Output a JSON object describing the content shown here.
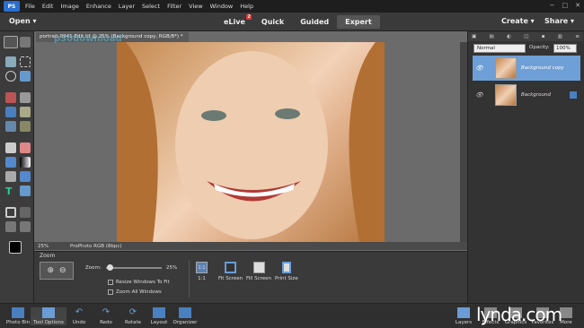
{
  "menubar": {
    "logo": "PS",
    "items": [
      "File",
      "Edit",
      "Image",
      "Enhance",
      "Layer",
      "Select",
      "Filter",
      "View",
      "Window",
      "Help"
    ],
    "window_controls": [
      "−",
      "□",
      "✕"
    ]
  },
  "topbar": {
    "open_label": "Open",
    "modes": [
      {
        "label": "eLive",
        "badge": "2"
      },
      {
        "label": "Quick"
      },
      {
        "label": "Guided"
      },
      {
        "label": "Expert"
      }
    ],
    "create_label": "Create",
    "share_label": "Share"
  },
  "document": {
    "tab_title": "portrait-0941-Edit.tif @ 25% (Background copy, RGB/8*) *",
    "watermark": "p30download",
    "status_zoom": "25%",
    "status_profile": "ProPhoto RGB (8bpc)"
  },
  "tool_options": {
    "title": "Zoom",
    "zoom_label": "Zoom:",
    "zoom_value": "25%",
    "resize_windows": "Resize Windows To Fit",
    "zoom_all": "Zoom All Windows",
    "btn_1to1": "1:1",
    "btn_fit": "Fit Screen",
    "btn_fill": "Fill Screen",
    "btn_print": "Print Size"
  },
  "layers": {
    "blend_mode": "Normal",
    "opacity_label": "Opacity:",
    "opacity_value": "100%",
    "items": [
      {
        "name": "Background copy"
      },
      {
        "name": "Background"
      }
    ]
  },
  "bottom_bar": {
    "left": [
      "Photo Bin",
      "Tool Options",
      "Undo",
      "Redo",
      "Rotate",
      "Layout",
      "Organizer"
    ],
    "right": [
      "Layers",
      "Effects",
      "Graphics",
      "Favorites",
      "More"
    ],
    "brand": "lynda.com"
  },
  "colors": {
    "accent": "#2a6fd1",
    "selected_layer": "#6e9fd6"
  }
}
